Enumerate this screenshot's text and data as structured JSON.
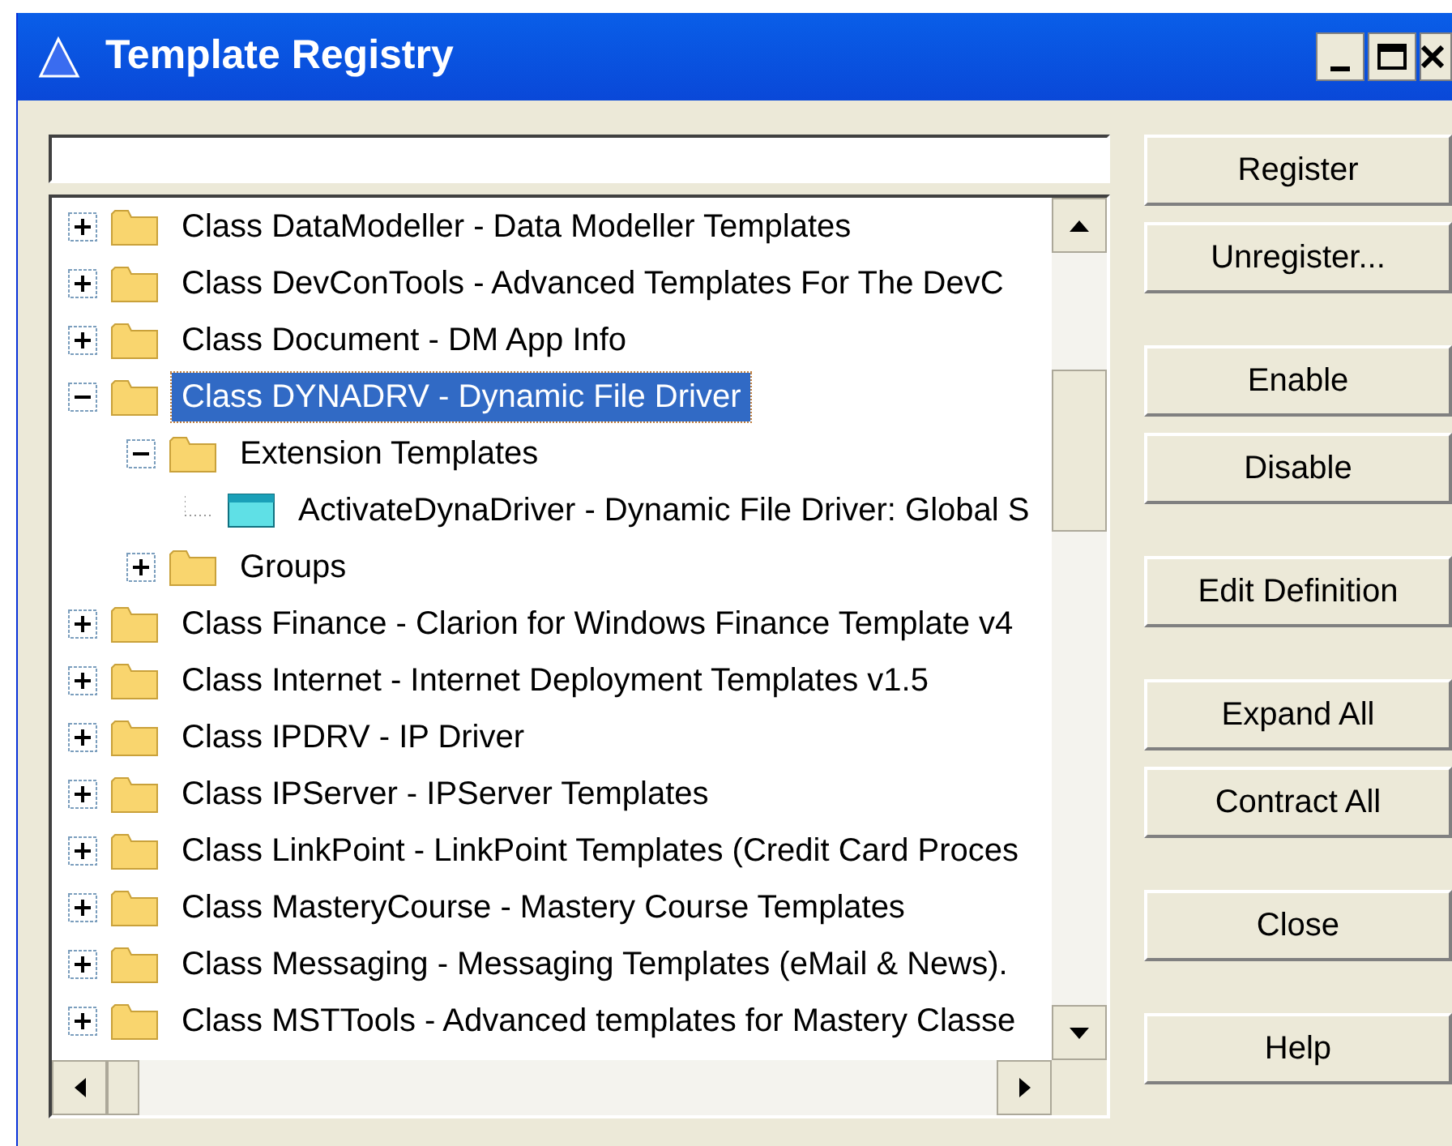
{
  "window": {
    "title": "Template Registry"
  },
  "tree": [
    {
      "label": "Class DataModeller - Data Modeller Templates",
      "kind": "folder",
      "expanded": false,
      "selected": false
    },
    {
      "label": "Class DevConTools - Advanced Templates For The DevC",
      "kind": "folder",
      "expanded": false,
      "selected": false
    },
    {
      "label": "Class Document - DM App Info",
      "kind": "folder",
      "expanded": false,
      "selected": false
    },
    {
      "label": "Class DYNADRV - Dynamic File Driver",
      "kind": "folder",
      "expanded": true,
      "selected": true,
      "children": [
        {
          "label": "Extension Templates",
          "kind": "folder",
          "expanded": true,
          "selected": false,
          "children": [
            {
              "label": "ActivateDynaDriver - Dynamic File Driver: Global S",
              "kind": "template",
              "selected": false
            }
          ]
        },
        {
          "label": "Groups",
          "kind": "folder",
          "expanded": false,
          "selected": false
        }
      ]
    },
    {
      "label": "Class Finance - Clarion for Windows Finance Template v4",
      "kind": "folder",
      "expanded": false,
      "selected": false
    },
    {
      "label": "Class Internet - Internet Deployment Templates v1.5",
      "kind": "folder",
      "expanded": false,
      "selected": false
    },
    {
      "label": "Class IPDRV - IP Driver",
      "kind": "folder",
      "expanded": false,
      "selected": false
    },
    {
      "label": "Class IPServer - IPServer Templates",
      "kind": "folder",
      "expanded": false,
      "selected": false
    },
    {
      "label": "Class LinkPoint - LinkPoint Templates (Credit Card Proces",
      "kind": "folder",
      "expanded": false,
      "selected": false
    },
    {
      "label": "Class MasteryCourse - Mastery Course Templates",
      "kind": "folder",
      "expanded": false,
      "selected": false
    },
    {
      "label": "Class Messaging - Messaging Templates (eMail & News).",
      "kind": "folder",
      "expanded": false,
      "selected": false
    },
    {
      "label": "Class MSTTools - Advanced templates for Mastery Classe",
      "kind": "folder",
      "expanded": false,
      "selected": false
    }
  ],
  "button_groups": [
    [
      "Register",
      "Unregister..."
    ],
    [
      "Enable",
      "Disable"
    ],
    [
      "Edit Definition"
    ],
    [
      "Expand All",
      "Contract All"
    ],
    [
      "Close"
    ],
    [
      "Help"
    ]
  ]
}
